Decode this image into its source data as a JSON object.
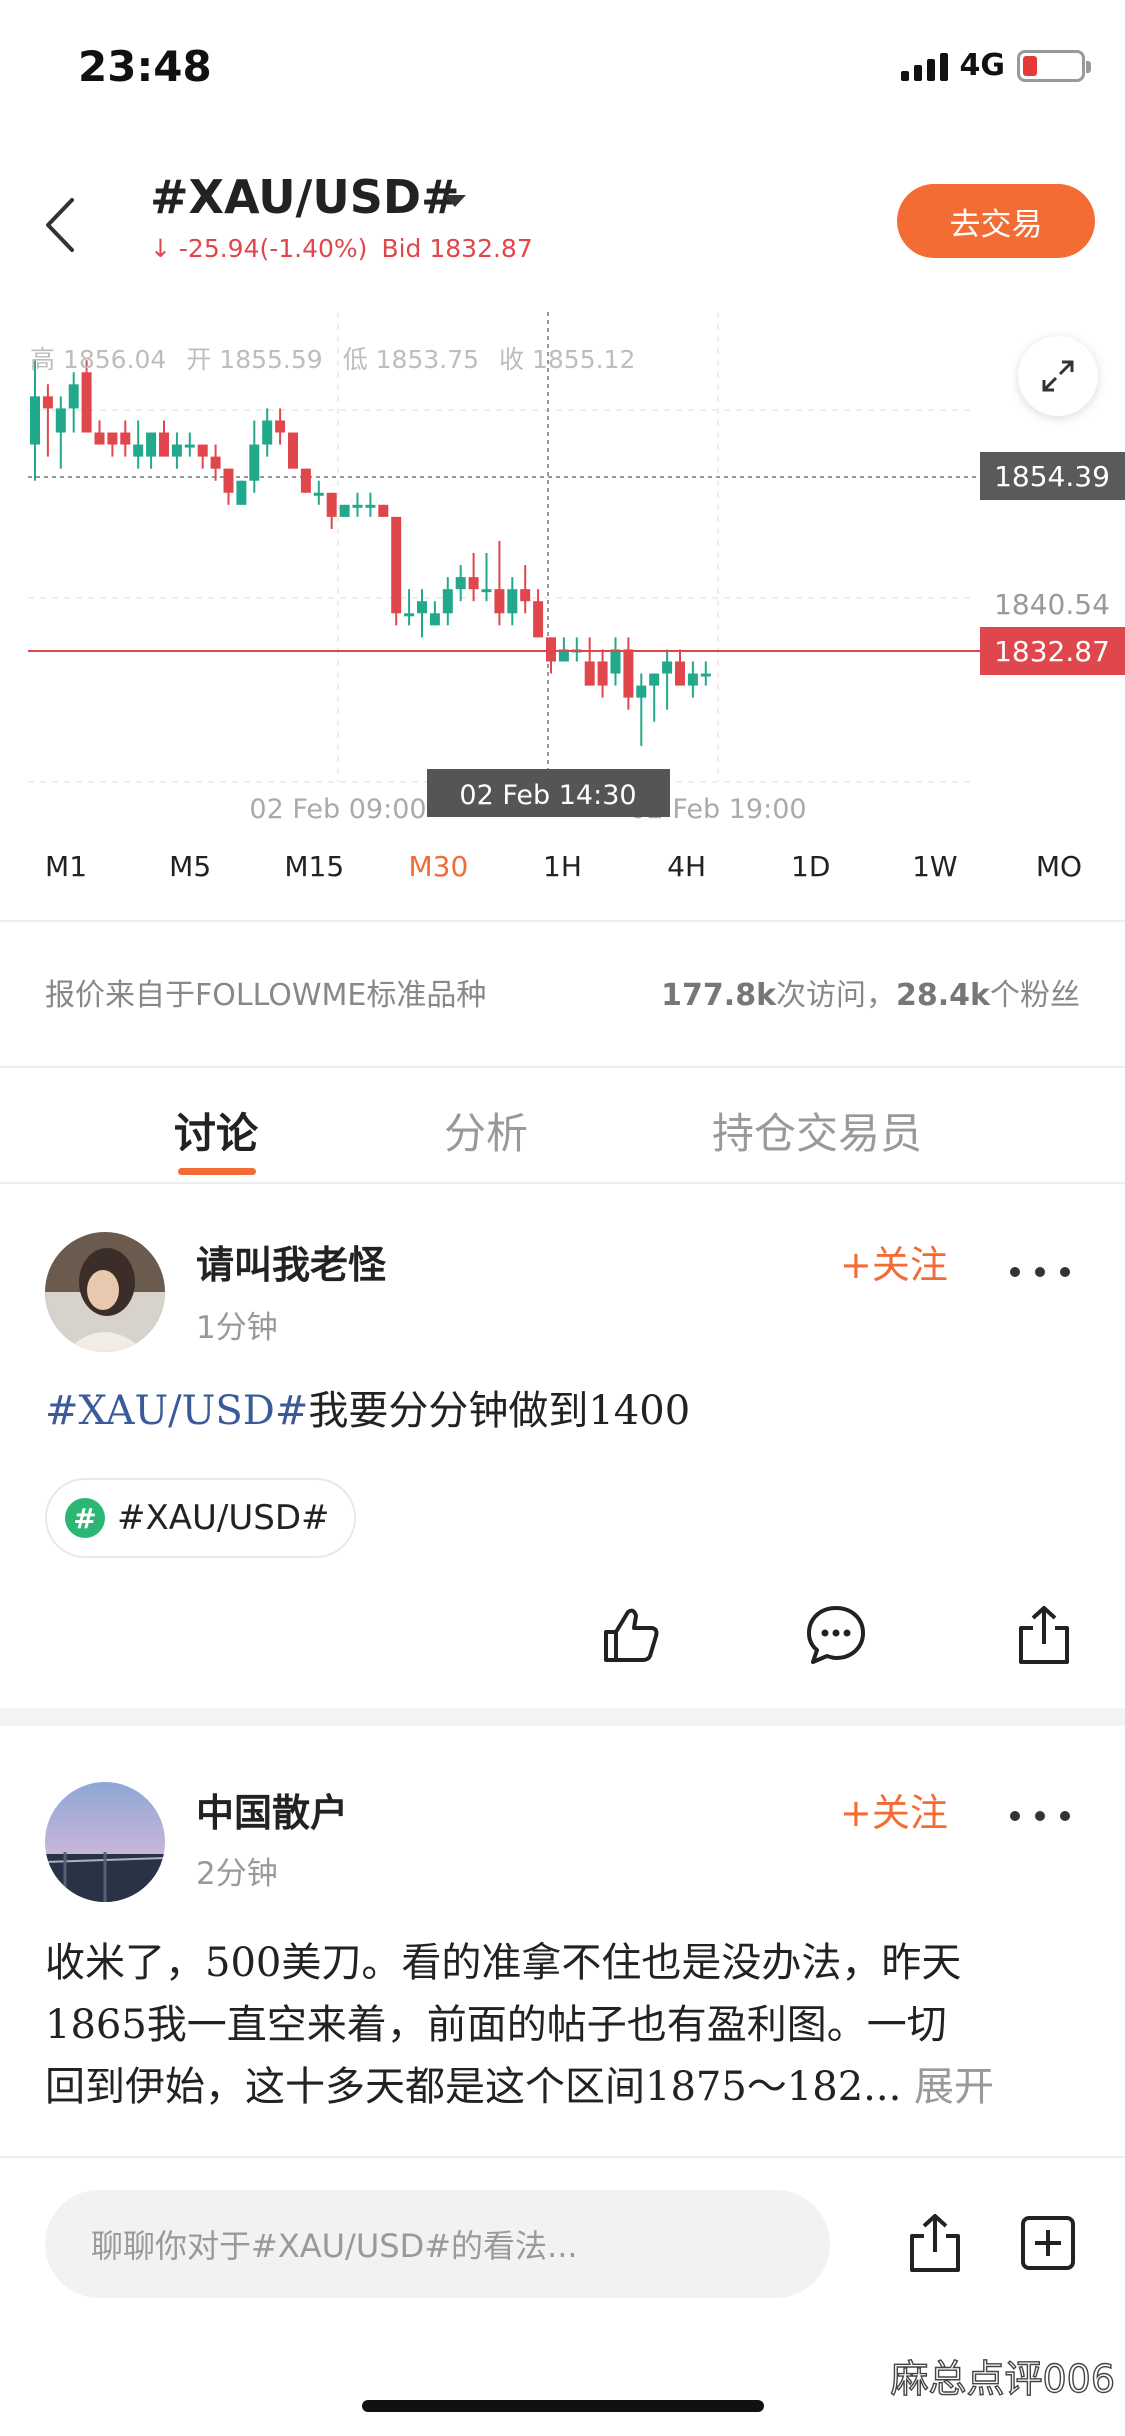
{
  "status_bar": {
    "time": "23:48",
    "network": "4G"
  },
  "header": {
    "symbol": "#XAU/USD#",
    "change": "↓ -25.94(-1.40%)",
    "bid": "Bid 1832.87",
    "trade_button": "去交易"
  },
  "chart": {
    "ohlc": {
      "high": "高 1856.04",
      "open": "开 1855.59",
      "low": "低 1853.75",
      "close": "收 1855.12"
    },
    "crosshair_time": "02 Feb 14:30",
    "colors": {
      "up": "#22a88a",
      "down": "#e0474c",
      "price_line": "#e0474c",
      "crosshair_label_bg": "#555555"
    }
  },
  "chart_data": {
    "type": "candlestick",
    "x_ticks": [
      "02 Feb 09:00",
      "02 Feb 14:30",
      "02 Feb 19:00"
    ],
    "y_tick_labels": [
      "1854.39",
      "1840.54",
      "1832.87"
    ],
    "current_price": 1832.87,
    "ylim": [
      1822,
      1861
    ],
    "candles": [
      {
        "o": 1850,
        "h": 1857,
        "l": 1847,
        "c": 1854
      },
      {
        "o": 1854,
        "h": 1855,
        "l": 1849,
        "c": 1853
      },
      {
        "o": 1851,
        "h": 1854,
        "l": 1848,
        "c": 1853
      },
      {
        "o": 1853,
        "h": 1856,
        "l": 1851,
        "c": 1855
      },
      {
        "o": 1856,
        "h": 1857,
        "l": 1851,
        "c": 1851
      },
      {
        "o": 1851,
        "h": 1852,
        "l": 1850,
        "c": 1850
      },
      {
        "o": 1851,
        "h": 1851,
        "l": 1849,
        "c": 1850
      },
      {
        "o": 1851,
        "h": 1852,
        "l": 1849,
        "c": 1850
      },
      {
        "o": 1849,
        "h": 1852,
        "l": 1848,
        "c": 1850
      },
      {
        "o": 1849,
        "h": 1851,
        "l": 1848,
        "c": 1851
      },
      {
        "o": 1851,
        "h": 1852,
        "l": 1849,
        "c": 1849
      },
      {
        "o": 1849,
        "h": 1851,
        "l": 1848,
        "c": 1850
      },
      {
        "o": 1850,
        "h": 1851,
        "l": 1849,
        "c": 1850
      },
      {
        "o": 1850,
        "h": 1850,
        "l": 1848,
        "c": 1849
      },
      {
        "o": 1849,
        "h": 1850,
        "l": 1847,
        "c": 1848
      },
      {
        "o": 1848,
        "h": 1848,
        "l": 1845,
        "c": 1846
      },
      {
        "o": 1845,
        "h": 1847,
        "l": 1845,
        "c": 1847
      },
      {
        "o": 1847,
        "h": 1852,
        "l": 1846,
        "c": 1850
      },
      {
        "o": 1850,
        "h": 1853,
        "l": 1849,
        "c": 1852
      },
      {
        "o": 1852,
        "h": 1853,
        "l": 1850,
        "c": 1851
      },
      {
        "o": 1851,
        "h": 1851,
        "l": 1848,
        "c": 1848
      },
      {
        "o": 1848,
        "h": 1848,
        "l": 1846,
        "c": 1846
      },
      {
        "o": 1846,
        "h": 1847,
        "l": 1845,
        "c": 1846
      },
      {
        "o": 1846,
        "h": 1846,
        "l": 1843,
        "c": 1844
      },
      {
        "o": 1844,
        "h": 1845,
        "l": 1844,
        "c": 1845
      },
      {
        "o": 1845,
        "h": 1846,
        "l": 1844,
        "c": 1845
      },
      {
        "o": 1845,
        "h": 1846,
        "l": 1844,
        "c": 1845
      },
      {
        "o": 1845,
        "h": 1845,
        "l": 1844,
        "c": 1844
      },
      {
        "o": 1844,
        "h": 1844,
        "l": 1835,
        "c": 1836
      },
      {
        "o": 1836,
        "h": 1838,
        "l": 1835,
        "c": 1836
      },
      {
        "o": 1836,
        "h": 1838,
        "l": 1834,
        "c": 1837
      },
      {
        "o": 1835,
        "h": 1837,
        "l": 1835,
        "c": 1836
      },
      {
        "o": 1836,
        "h": 1839,
        "l": 1835,
        "c": 1838
      },
      {
        "o": 1838,
        "h": 1840,
        "l": 1837,
        "c": 1839
      },
      {
        "o": 1839,
        "h": 1841,
        "l": 1837,
        "c": 1838
      },
      {
        "o": 1838,
        "h": 1841,
        "l": 1837,
        "c": 1838
      },
      {
        "o": 1838,
        "h": 1842,
        "l": 1835,
        "c": 1836
      },
      {
        "o": 1836,
        "h": 1839,
        "l": 1835,
        "c": 1838
      },
      {
        "o": 1838,
        "h": 1840,
        "l": 1836,
        "c": 1837
      },
      {
        "o": 1837,
        "h": 1838,
        "l": 1834,
        "c": 1834
      },
      {
        "o": 1834,
        "h": 1834,
        "l": 1831,
        "c": 1832
      },
      {
        "o": 1832,
        "h": 1834,
        "l": 1832,
        "c": 1833
      },
      {
        "o": 1833,
        "h": 1834,
        "l": 1832,
        "c": 1833
      },
      {
        "o": 1832,
        "h": 1834,
        "l": 1830,
        "c": 1830
      },
      {
        "o": 1832,
        "h": 1833,
        "l": 1829,
        "c": 1830
      },
      {
        "o": 1831,
        "h": 1834,
        "l": 1830,
        "c": 1833
      },
      {
        "o": 1833,
        "h": 1834,
        "l": 1828,
        "c": 1829
      },
      {
        "o": 1829,
        "h": 1831,
        "l": 1825,
        "c": 1830
      },
      {
        "o": 1830,
        "h": 1831,
        "l": 1827,
        "c": 1831
      },
      {
        "o": 1831,
        "h": 1833,
        "l": 1828,
        "c": 1832
      },
      {
        "o": 1832,
        "h": 1833,
        "l": 1830,
        "c": 1830
      },
      {
        "o": 1830,
        "h": 1832,
        "l": 1829,
        "c": 1831
      },
      {
        "o": 1831,
        "h": 1832,
        "l": 1830,
        "c": 1831
      }
    ]
  },
  "timeframes": [
    "M1",
    "M5",
    "M15",
    "M30",
    "1H",
    "4H",
    "1D",
    "1W",
    "MO"
  ],
  "active_timeframe": "M30",
  "info": {
    "source": "报价来自于FOLLOWME标准品种",
    "visits_num": "177.8k",
    "visits_label": "次访问，",
    "fans_num": "28.4k",
    "fans_label": "个粉丝"
  },
  "tabs": [
    "讨论",
    "分析",
    "持仓交易员"
  ],
  "posts": [
    {
      "username": "请叫我老怪",
      "time": "1分钟",
      "follow": "+关注",
      "tag_prefix": "#XAU/USD#",
      "text": "我要分分钟做到1400",
      "chip": "#XAU/USD#",
      "chip_icon": "#"
    },
    {
      "username": "中国散户",
      "time": "2分钟",
      "follow": "+关注",
      "line1": "收米了，500美刀。看的准拿不住也是没办法，昨天",
      "line2": "1865我一直空来着，前面的帖子也有盈利图。一切",
      "line3": "回到伊始，这十多天都是这个区间1875～182...",
      "expand": "展开"
    }
  ],
  "bottom": {
    "placeholder": "聊聊你对于#XAU/USD#的看法...",
    "watermark": "麻总点评006"
  }
}
